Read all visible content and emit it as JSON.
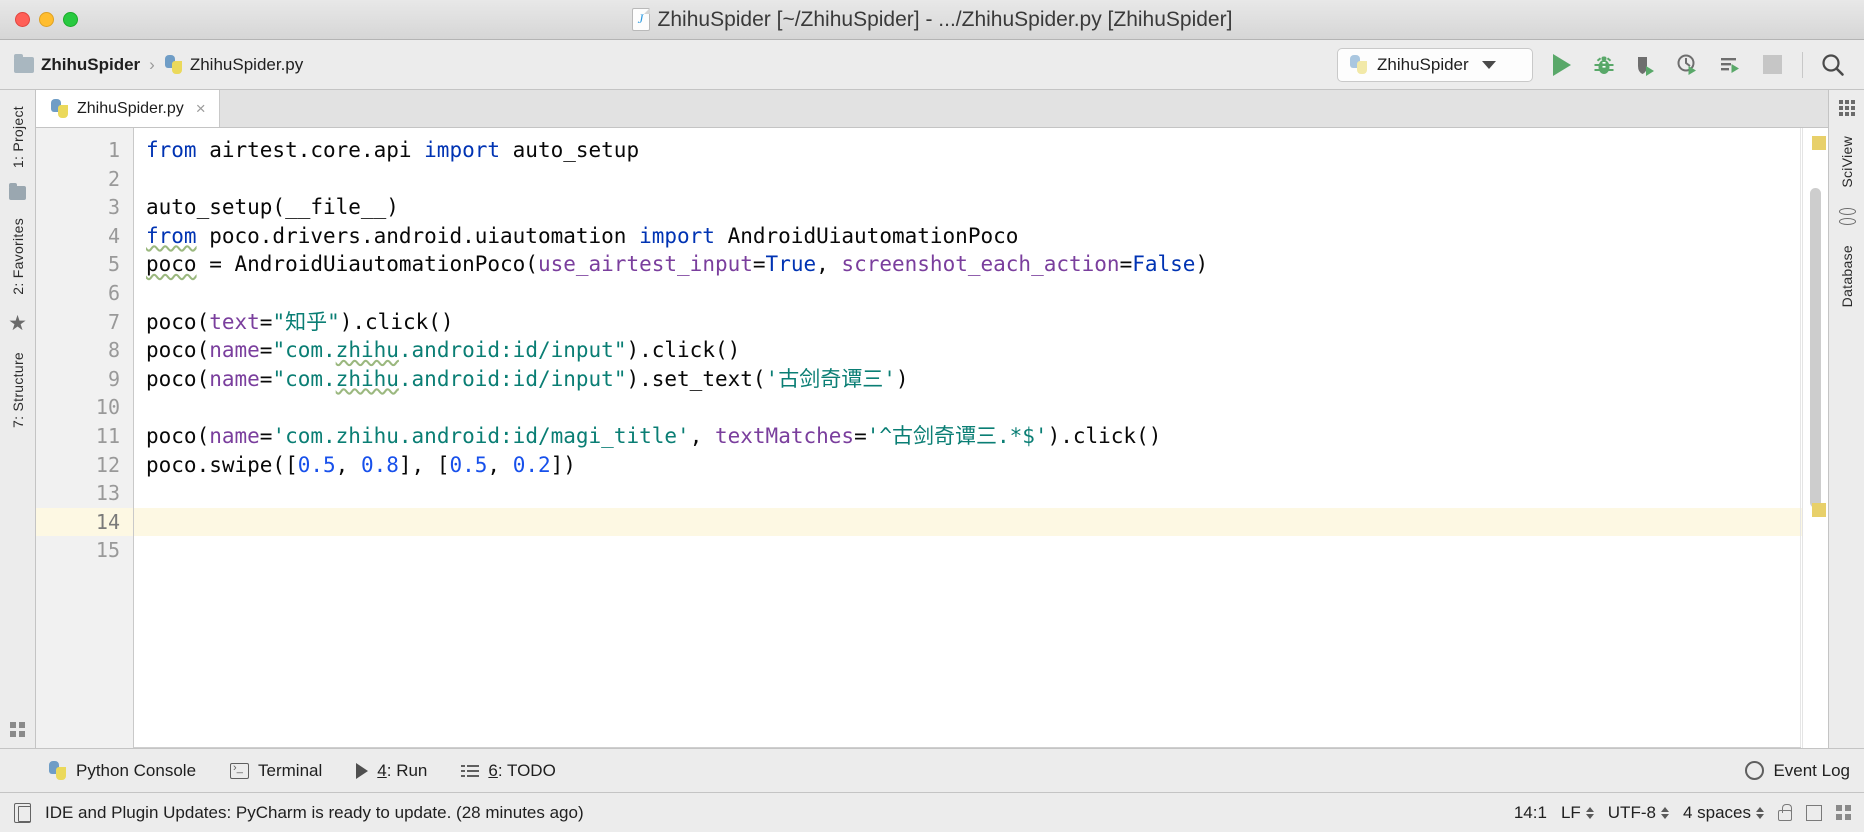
{
  "window": {
    "title": "ZhihuSpider [~/ZhihuSpider] - .../ZhihuSpider.py [ZhihuSpider]",
    "doc_icon": "python-file-icon",
    "close_label": "",
    "minimize_label": "",
    "zoom_label": ""
  },
  "toolbar": {
    "breadcrumb": [
      {
        "label": "ZhihuSpider",
        "icon": "folder-icon",
        "bold": true
      },
      {
        "label": "ZhihuSpider.py",
        "icon": "python-file-icon",
        "bold": false
      }
    ],
    "breadcrumb_separator": "›",
    "run_config": {
      "label": "ZhihuSpider",
      "icon": "python-icon"
    },
    "buttons": [
      {
        "name": "run-button",
        "label": "Run"
      },
      {
        "name": "debug-button",
        "label": "Debug"
      },
      {
        "name": "run-with-coverage-button",
        "label": "Run with Coverage"
      },
      {
        "name": "profile-button",
        "label": "Profile"
      },
      {
        "name": "run-with-console-button",
        "label": "Run with Console"
      },
      {
        "name": "stop-button",
        "label": "Stop"
      },
      {
        "name": "search-button",
        "label": "Search Everywhere"
      }
    ]
  },
  "left_strip": {
    "tabs": [
      {
        "label": "1: Project"
      },
      {
        "label": "2: Favorites"
      },
      {
        "label": "7: Structure"
      }
    ]
  },
  "right_strip": {
    "tabs": [
      {
        "label": "SciView"
      },
      {
        "label": "Database"
      }
    ]
  },
  "editor": {
    "tab": {
      "label": "ZhihuSpider.py",
      "close": "×"
    },
    "current_line": 14,
    "lines": [
      {
        "n": 1,
        "tokens": [
          {
            "t": "from",
            "c": "kw"
          },
          {
            "t": " airtest.core.api ",
            "c": "plain"
          },
          {
            "t": "import",
            "c": "kw"
          },
          {
            "t": " auto_setup",
            "c": "plain"
          }
        ]
      },
      {
        "n": 2,
        "tokens": []
      },
      {
        "n": 3,
        "tokens": [
          {
            "t": "auto_setup(__file__)",
            "c": "plain"
          }
        ]
      },
      {
        "n": 4,
        "tokens": [
          {
            "t": "from",
            "c": "kw typo"
          },
          {
            "t": " poco.drivers.android.uiautomation ",
            "c": "plain"
          },
          {
            "t": "import",
            "c": "kw"
          },
          {
            "t": " AndroidUiautomationPoco",
            "c": "plain"
          }
        ]
      },
      {
        "n": 5,
        "tokens": [
          {
            "t": "poco",
            "c": "plain typo"
          },
          {
            "t": " = AndroidUiautomationPoco(",
            "c": "plain"
          },
          {
            "t": "use_airtest_input",
            "c": "kwarg"
          },
          {
            "t": "=",
            "c": "plain"
          },
          {
            "t": "True",
            "c": "kw"
          },
          {
            "t": ", ",
            "c": "plain"
          },
          {
            "t": "screenshot_each_action",
            "c": "kwarg"
          },
          {
            "t": "=",
            "c": "plain"
          },
          {
            "t": "False",
            "c": "kw"
          },
          {
            "t": ")",
            "c": "plain"
          }
        ]
      },
      {
        "n": 6,
        "tokens": []
      },
      {
        "n": 7,
        "tokens": [
          {
            "t": "poco(",
            "c": "plain"
          },
          {
            "t": "text",
            "c": "kwarg"
          },
          {
            "t": "=",
            "c": "plain"
          },
          {
            "t": "\"知乎\"",
            "c": "str"
          },
          {
            "t": ").click()",
            "c": "plain"
          }
        ]
      },
      {
        "n": 8,
        "tokens": [
          {
            "t": "poco(",
            "c": "plain"
          },
          {
            "t": "name",
            "c": "kwarg"
          },
          {
            "t": "=",
            "c": "plain"
          },
          {
            "t": "\"com.",
            "c": "str"
          },
          {
            "t": "zhihu",
            "c": "str typo"
          },
          {
            "t": ".android:id/input\"",
            "c": "str"
          },
          {
            "t": ").click()",
            "c": "plain"
          }
        ]
      },
      {
        "n": 9,
        "tokens": [
          {
            "t": "poco(",
            "c": "plain"
          },
          {
            "t": "name",
            "c": "kwarg"
          },
          {
            "t": "=",
            "c": "plain"
          },
          {
            "t": "\"com.",
            "c": "str"
          },
          {
            "t": "zhihu",
            "c": "str typo"
          },
          {
            "t": ".android:id/input\"",
            "c": "str"
          },
          {
            "t": ").set_text(",
            "c": "plain"
          },
          {
            "t": "'古剑奇谭三'",
            "c": "str"
          },
          {
            "t": ")",
            "c": "plain"
          }
        ]
      },
      {
        "n": 10,
        "tokens": []
      },
      {
        "n": 11,
        "tokens": [
          {
            "t": "poco(",
            "c": "plain"
          },
          {
            "t": "name",
            "c": "kwarg"
          },
          {
            "t": "=",
            "c": "plain"
          },
          {
            "t": "'com.zhihu.android:id/magi_title'",
            "c": "str"
          },
          {
            "t": ", ",
            "c": "plain"
          },
          {
            "t": "textMatches",
            "c": "kwarg"
          },
          {
            "t": "=",
            "c": "plain"
          },
          {
            "t": "'^古剑奇谭三.*$'",
            "c": "str"
          },
          {
            "t": ").click()",
            "c": "plain"
          }
        ]
      },
      {
        "n": 12,
        "tokens": [
          {
            "t": "poco.swipe([",
            "c": "plain"
          },
          {
            "t": "0.5",
            "c": "num"
          },
          {
            "t": ", ",
            "c": "plain"
          },
          {
            "t": "0.8",
            "c": "num"
          },
          {
            "t": "], [",
            "c": "plain"
          },
          {
            "t": "0.5",
            "c": "num"
          },
          {
            "t": ", ",
            "c": "plain"
          },
          {
            "t": "0.2",
            "c": "num"
          },
          {
            "t": "])",
            "c": "plain"
          }
        ]
      },
      {
        "n": 13,
        "tokens": []
      },
      {
        "n": 14,
        "tokens": []
      },
      {
        "n": 15,
        "tokens": []
      }
    ]
  },
  "bottom_bar": {
    "items": [
      {
        "label": "Python Console",
        "icon": "python-icon",
        "underline": ""
      },
      {
        "label": "Terminal",
        "icon": "terminal-icon",
        "underline": ""
      },
      {
        "label": ": Run",
        "icon": "play-icon",
        "underline": "4"
      },
      {
        "label": ": TODO",
        "icon": "list-icon",
        "underline": "6"
      }
    ],
    "event_log": {
      "label": "Event Log",
      "icon": "circle-icon"
    }
  },
  "status_bar": {
    "message": "IDE and Plugin Updates: PyCharm is ready to update. (28 minutes ago)",
    "caret": "14:1",
    "line_separator": "LF",
    "encoding": "UTF-8",
    "indent": "4 spaces"
  },
  "colors": {
    "accent_green": "#59a869",
    "keyword_blue": "#0033b3",
    "string_teal": "#0a7e74",
    "kwarg_purple": "#7a3e9d",
    "number_blue": "#1750eb",
    "current_line": "#fdf8e3",
    "chrome_gray": "#ececec"
  }
}
